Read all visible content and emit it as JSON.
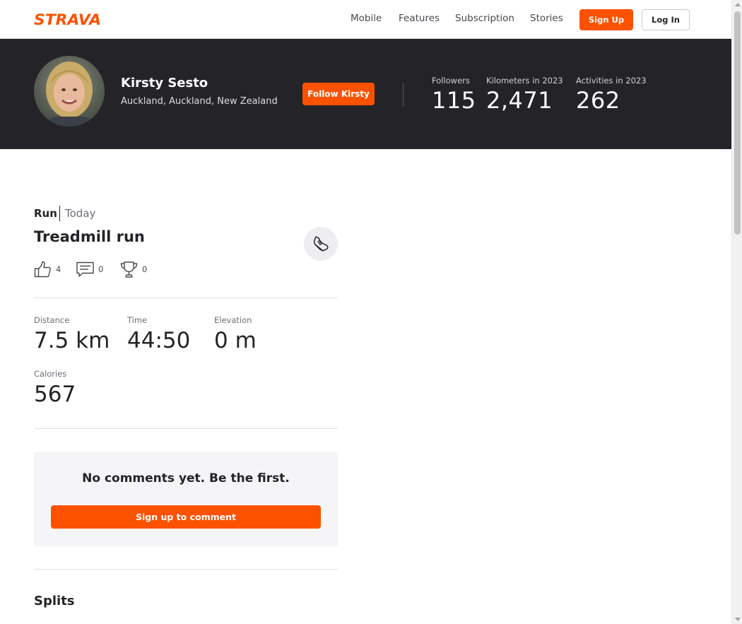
{
  "brand": {
    "logo_text": "STRAVA",
    "accent_color": "#fc5200"
  },
  "nav": {
    "links": [
      "Mobile",
      "Features",
      "Subscription",
      "Stories"
    ],
    "signup_label": "Sign Up",
    "login_label": "Log In"
  },
  "athlete": {
    "name": "Kirsty Sesto",
    "location": "Auckland, Auckland, New Zealand",
    "follow_label": "Follow Kirsty",
    "stats": [
      {
        "label": "Followers",
        "value": "115"
      },
      {
        "label": "Kilometers in 2023",
        "value": "2,471"
      },
      {
        "label": "Activities in 2023",
        "value": "262"
      }
    ]
  },
  "activity": {
    "type": "Run",
    "date": "Today",
    "title": "Treadmill run",
    "icon": "shoe-icon",
    "kudos_count": "4",
    "comments_count": "0",
    "achievements_count": "0",
    "metrics": {
      "distance": {
        "label": "Distance",
        "value": "7.5 km"
      },
      "time": {
        "label": "Time",
        "value": "44:50"
      },
      "elevation": {
        "label": "Elevation",
        "value": "0 m"
      },
      "calories": {
        "label": "Calories",
        "value": "567"
      }
    }
  },
  "comments": {
    "empty_text": "No comments yet. Be the first.",
    "cta_label": "Sign up to comment"
  },
  "splits": {
    "title": "Splits"
  }
}
